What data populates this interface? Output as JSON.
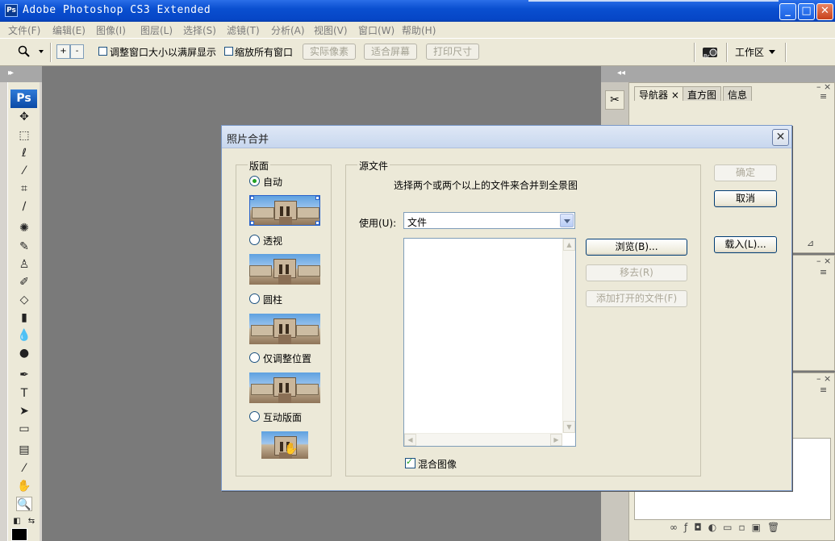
{
  "app": {
    "title": "Adobe Photoshop CS3 Extended",
    "icon_text": "Ps"
  },
  "window_controls": {
    "minimize": "_",
    "maximize": "□",
    "close": "✕"
  },
  "menu": [
    "文件(F)",
    "编辑(E)",
    "图像(I)",
    "图层(L)",
    "选择(S)",
    "滤镜(T)",
    "分析(A)",
    "视图(V)",
    "窗口(W)",
    "帮助(H)"
  ],
  "options_bar": {
    "zoom_in": "+",
    "zoom_out": "-",
    "resize_windows_label": "调整窗口大小以满屏显示",
    "zoom_all_label": "缩放所有窗口",
    "actual_pixels": "实际像素",
    "fit_screen": "适合屏幕",
    "print_size": "打印尺寸",
    "workspace_label": "工作区",
    "bridge_icon_text": "Br"
  },
  "tools_panel": {
    "logo": "Ps"
  },
  "right_panel": {
    "tabs": [
      "导航器",
      "直方图",
      "信息"
    ],
    "tab_close": "×"
  },
  "dialog": {
    "title": "照片合并",
    "close": "✕",
    "layout_group": "版面",
    "layout_options": [
      "自动",
      "透视",
      "圆柱",
      "仅调整位置",
      "互动版面"
    ],
    "source_group": "源文件",
    "instruction": "选择两个或两个以上的文件来合并到全景图",
    "use_label": "使用(U):",
    "use_value": "文件",
    "browse": "浏览(B)...",
    "remove": "移去(R)",
    "add_open": "添加打开的文件(F)",
    "blend_label": "混合图像",
    "ok": "确定",
    "cancel": "取消",
    "load": "载入(L)..."
  },
  "colors": {
    "titlebar": "#0a4fd0",
    "dialog_bg": "#ece9d8",
    "workspace": "#7a7a7a",
    "radio_dot": "#21a121"
  }
}
